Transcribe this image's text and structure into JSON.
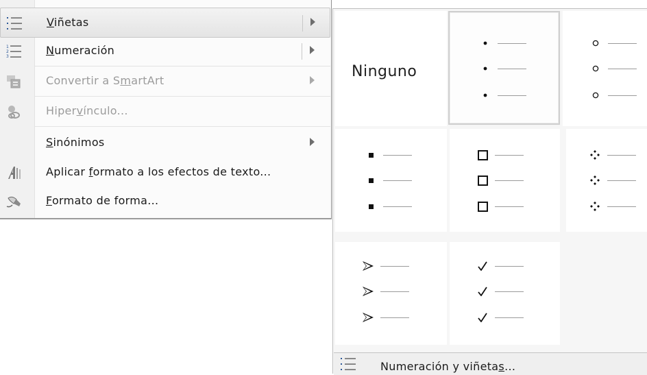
{
  "menu": {
    "items": [
      {
        "label_pre": "",
        "label_u": "V",
        "label_post": "iñetas",
        "enabled": true,
        "has_submenu": true,
        "highlighted": true,
        "split": true,
        "icon": "bullets-icon"
      },
      {
        "label_pre": "",
        "label_u": "N",
        "label_post": "umeración",
        "enabled": true,
        "has_submenu": true,
        "highlighted": false,
        "split": true,
        "icon": "numbering-icon"
      },
      {
        "label_pre": "Convertir a S",
        "label_u": "m",
        "label_post": "artArt",
        "enabled": false,
        "has_submenu": true,
        "highlighted": false,
        "split": false,
        "icon": "smartart-icon"
      },
      {
        "label_pre": "Hiper",
        "label_u": "v",
        "label_post": "ínculo...",
        "enabled": false,
        "has_submenu": false,
        "highlighted": false,
        "split": false,
        "icon": "hyperlink-icon"
      },
      {
        "label_pre": "",
        "label_u": "S",
        "label_post": "inónimos",
        "enabled": true,
        "has_submenu": true,
        "highlighted": false,
        "split": false,
        "icon": ""
      },
      {
        "label_pre": "Aplicar ",
        "label_u": "f",
        "label_post": "ormato a los efectos de texto...",
        "enabled": true,
        "has_submenu": false,
        "highlighted": false,
        "split": false,
        "icon": "text-effects-icon"
      },
      {
        "label_pre": "",
        "label_u": "F",
        "label_post": "ormato de forma...",
        "enabled": true,
        "has_submenu": false,
        "highlighted": false,
        "split": false,
        "icon": "format-shape-icon"
      }
    ]
  },
  "gallery": {
    "none_label": "Ninguno",
    "styles": [
      "none",
      "filled-round",
      "hollow-round",
      "filled-square",
      "hollow-square",
      "four-diamond",
      "arrowhead",
      "checkmark"
    ],
    "selected_style": "filled-round",
    "footer": {
      "label_pre": "Numeración y viñeta",
      "label_u": "s",
      "label_post": "..."
    }
  },
  "colors": {
    "highlight": "#e8e8e8",
    "disabled_text": "#9b9b9b",
    "accent": "#2b5797"
  }
}
